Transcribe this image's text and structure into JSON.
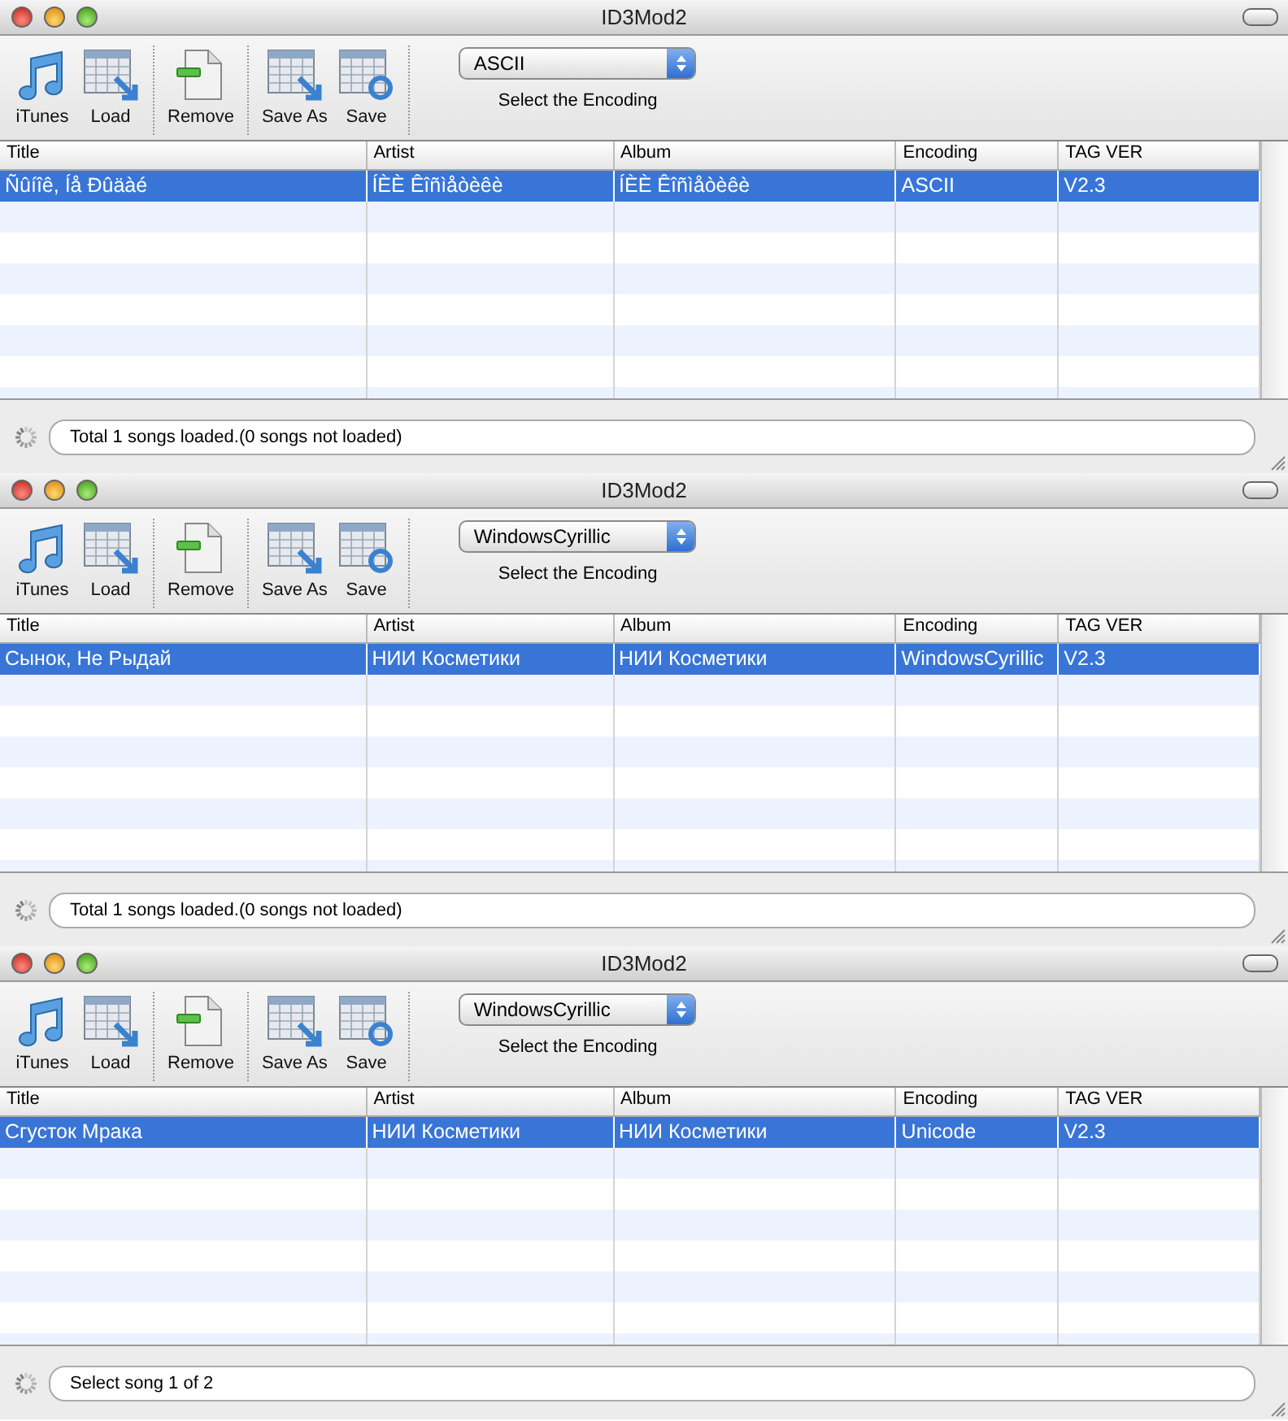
{
  "windows": [
    {
      "title": "ID3Mod2",
      "toolbar_groups": [
        {
          "items": [
            {
              "kind": "itunes",
              "label": "iTunes"
            },
            {
              "kind": "load",
              "label": "Load"
            }
          ]
        },
        {
          "items": [
            {
              "kind": "remove",
              "label": "Remove"
            }
          ]
        },
        {
          "items": [
            {
              "kind": "save-as",
              "label": "Save As"
            },
            {
              "kind": "save",
              "label": "Save"
            }
          ]
        }
      ],
      "encoding": {
        "value": "ASCII",
        "label": "Select the Encoding"
      },
      "table": {
        "columns": [
          "Title",
          "Artist",
          "Album",
          "Encoding",
          "TAG VER"
        ],
        "rows": [
          {
            "selected": true,
            "cells": [
              "Ñûíîê, Íå Ðûäàé",
              "ÍÈÈ Êîñìåòèêè",
              "ÍÈÈ Êîñìåòèêè",
              "ASCII",
              "V2.3"
            ]
          }
        ]
      },
      "status": "Total 1 songs loaded.(0 songs not loaded)"
    },
    {
      "title": "ID3Mod2",
      "toolbar_groups": [
        {
          "items": [
            {
              "kind": "itunes",
              "label": "iTunes"
            },
            {
              "kind": "load",
              "label": "Load"
            }
          ]
        },
        {
          "items": [
            {
              "kind": "remove",
              "label": "Remove"
            }
          ]
        },
        {
          "items": [
            {
              "kind": "save-as",
              "label": "Save As"
            },
            {
              "kind": "save",
              "label": "Save"
            }
          ]
        }
      ],
      "encoding": {
        "value": "WindowsCyrillic",
        "label": "Select the Encoding"
      },
      "table": {
        "columns": [
          "Title",
          "Artist",
          "Album",
          "Encoding",
          "TAG VER"
        ],
        "rows": [
          {
            "selected": true,
            "cells": [
              "Сынок, Не Рыдай",
              "НИИ Косметики",
              "НИИ Косметики",
              "WindowsCyrillic",
              "V2.3"
            ]
          }
        ]
      },
      "status": "Total 1 songs loaded.(0 songs not loaded)"
    },
    {
      "title": "ID3Mod2",
      "toolbar_groups": [
        {
          "items": [
            {
              "kind": "itunes",
              "label": "iTunes"
            },
            {
              "kind": "load",
              "label": "Load"
            }
          ]
        },
        {
          "items": [
            {
              "kind": "remove",
              "label": "Remove"
            }
          ]
        },
        {
          "items": [
            {
              "kind": "save-as",
              "label": "Save As"
            },
            {
              "kind": "save",
              "label": "Save"
            }
          ]
        }
      ],
      "encoding": {
        "value": "WindowsCyrillic",
        "label": "Select the Encoding"
      },
      "table": {
        "columns": [
          "Title",
          "Artist",
          "Album",
          "Encoding",
          "TAG VER"
        ],
        "rows": [
          {
            "selected": true,
            "cells": [
              "Сгусток Мрака",
              "НИИ Косметики",
              "НИИ Косметики",
              "Unicode",
              "V2.3"
            ]
          }
        ]
      },
      "status": "Select song 1 of 2"
    }
  ]
}
